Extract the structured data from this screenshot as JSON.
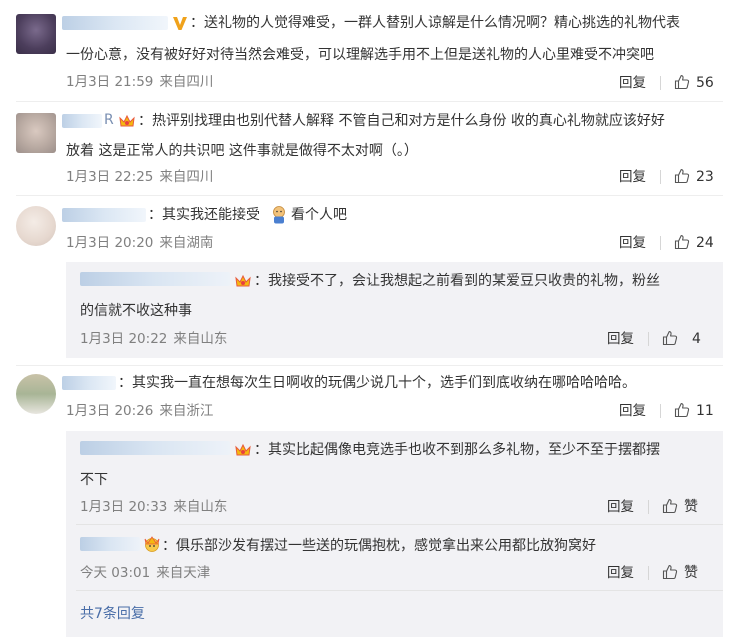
{
  "comments": [
    {
      "text_line1": "：送礼物的人觉得难受，一群人替别人谅解是什么情况啊？精心挑选的礼物代表",
      "text_line2": "一份心意，没有被好好对待当然会难受，可以理解选手用不上但是送礼物的人心里难受不冲突吧",
      "date": "1月3日 21:59",
      "location": "来自四川",
      "reply_label": "回复",
      "likes": "56"
    },
    {
      "text_line1": "：热评别找理由也别代替人解释 不管自己和对方是什么身份 收的真心礼物就应该好好",
      "text_line2": "放着 这是正常人的共识吧 这件事就是做得不太对啊（。）",
      "name_fragment": "R",
      "date": "1月3日 22:25",
      "location": "来自四川",
      "reply_label": "回复",
      "likes": "23"
    },
    {
      "text_before": "：其实我还能接受",
      "text_after": "看个人吧",
      "date": "1月3日 20:20",
      "location": "来自湖南",
      "reply_label": "回复",
      "likes": "24",
      "replies": [
        {
          "text_line1": "：我接受不了，会让我想起之前看到的某爱豆只收贵的礼物，粉丝",
          "text_line2": "的信就不收这种事",
          "date": "1月3日 20:22",
          "location": "来自山东",
          "reply_label": "回复",
          "likes": "4"
        }
      ]
    },
    {
      "text_line1": "：其实我一直在想每次生日啊收的玩偶少说几十个，选手们到底收纳在哪哈哈哈哈。",
      "date": "1月3日 20:26",
      "location": "来自浙江",
      "reply_label": "回复",
      "likes": "11",
      "replies": [
        {
          "text_line1": "：其实比起偶像电竞选手也收不到那么多礼物，至少不至于摆都摆",
          "text_line2": "不下",
          "date": "1月3日 20:33",
          "location": "来自山东",
          "reply_label": "回复",
          "likes": "赞"
        },
        {
          "text_line1": "：俱乐部沙发有摆过一些送的玩偶抱枕，感觉拿出来公用都比放狗窝好",
          "date": "今天 03:01",
          "location": "来自天津",
          "reply_label": "回复",
          "likes": "赞"
        }
      ],
      "more_replies": "共7条回复"
    }
  ],
  "colors": {
    "text": "#333333",
    "meta": "#808080",
    "link": "#4a6ea8",
    "reply_bg": "#f2f2f5",
    "vip": "#f0a21b"
  }
}
